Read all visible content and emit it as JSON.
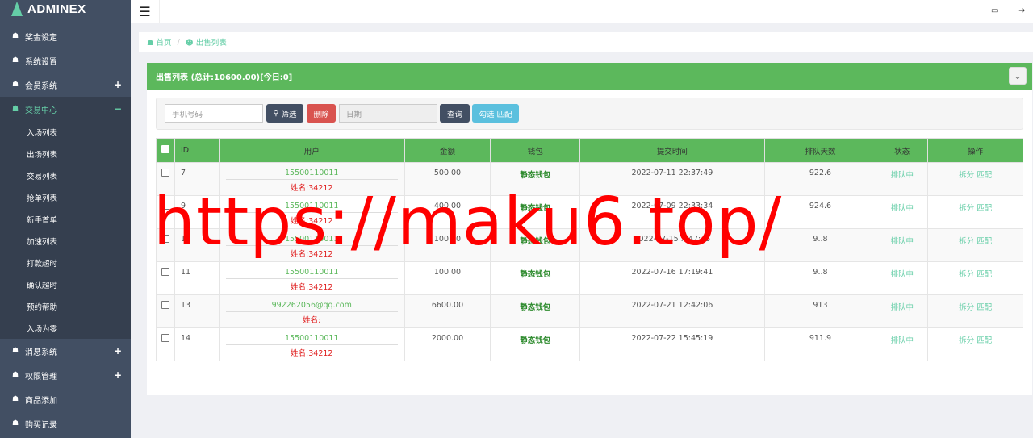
{
  "app": {
    "logo": "ADMINEX"
  },
  "sidebar": {
    "items": [
      {
        "label": "奖金设定",
        "expanded": false,
        "toggle": ""
      },
      {
        "label": "系统设置",
        "expanded": false,
        "toggle": ""
      },
      {
        "label": "会员系统",
        "expanded": false,
        "toggle": "+"
      },
      {
        "label": "交易中心",
        "expanded": true,
        "toggle": "−"
      },
      {
        "label": "消息系统",
        "expanded": false,
        "toggle": "+"
      },
      {
        "label": "权限管理",
        "expanded": false,
        "toggle": "+"
      },
      {
        "label": "商品添加",
        "expanded": false,
        "toggle": ""
      },
      {
        "label": "购买记录",
        "expanded": false,
        "toggle": ""
      }
    ],
    "submenu": [
      "入场列表",
      "出场列表",
      "交易列表",
      "抢单列表",
      "新手首单",
      "加速列表",
      "打款超时",
      "确认超时",
      "预约帮助",
      "入场为零"
    ]
  },
  "breadcrumb": {
    "home": "首页",
    "current": "出售列表"
  },
  "panel": {
    "title": "出售列表 (总计:10600.00)[今日:0]"
  },
  "filters": {
    "phone_placeholder": "手机号码",
    "filter_label": "筛选",
    "delete_label": "删除",
    "date_placeholder": "日期",
    "query_label": "查询",
    "match_label": "勾选 匹配"
  },
  "table": {
    "headers": [
      "ID",
      "用户",
      "金额",
      "钱包",
      "提交时间",
      "排队天数",
      "状态",
      "操作"
    ],
    "rows": [
      {
        "id": "7",
        "user": "15500110011",
        "name": "姓名:34212",
        "amount": "500.00",
        "wallet": "静态钱包",
        "time": "2022-07-11 22:37:49",
        "days": "922.6",
        "status": "排队中",
        "op": "拆分 匹配"
      },
      {
        "id": "9",
        "user": "15500110011",
        "name": "姓名:34212",
        "amount": "400.00",
        "wallet": "静态钱包",
        "time": "2022-07-09 22:33:34",
        "days": "924.6",
        "status": "排队中",
        "op": "拆分 匹配"
      },
      {
        "id": "10",
        "user": "15500110011",
        "name": "姓名:34212",
        "amount": "100.00",
        "wallet": "静态钱包",
        "time": "2022-07-15 ..:47:35",
        "days": "9..8",
        "status": "排队中",
        "op": "拆分 匹配"
      },
      {
        "id": "11",
        "user": "15500110011",
        "name": "姓名:34212",
        "amount": "100.00",
        "wallet": "静态钱包",
        "time": "2022-07-16 17:19:41",
        "days": "9..8",
        "status": "排队中",
        "op": "拆分 匹配"
      },
      {
        "id": "13",
        "user": "992262056@qq.com",
        "name": "姓名:",
        "amount": "6600.00",
        "wallet": "静态钱包",
        "time": "2022-07-21 12:42:06",
        "days": "913",
        "status": "排队中",
        "op": "拆分 匹配"
      },
      {
        "id": "14",
        "user": "15500110011",
        "name": "姓名:34212",
        "amount": "2000.00",
        "wallet": "静态钱包",
        "time": "2022-07-22 15:45:19",
        "days": "911.9",
        "status": "排队中",
        "op": "拆分 匹配"
      }
    ]
  },
  "watermark": "https://maku6.top/",
  "colors": {
    "sidebar": "#424f63",
    "accent": "#65cea7",
    "success": "#5cb85c",
    "danger": "#d9534f",
    "info": "#5bc0de"
  }
}
